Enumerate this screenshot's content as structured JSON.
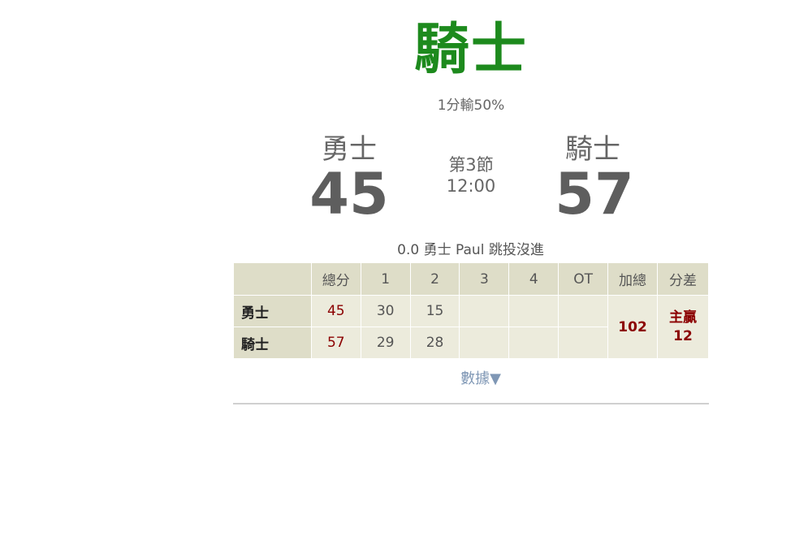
{
  "header": {
    "winner_team": "騎士",
    "winner_subtitle": "1分輸50%"
  },
  "scoreboard": {
    "home": {
      "name": "勇士",
      "score": "45"
    },
    "away": {
      "name": "騎士",
      "score": "57"
    },
    "period": "第3節",
    "clock": "12:00"
  },
  "last_play": "0.0 勇士 Paul 跳投沒進",
  "box_score": {
    "headers": [
      "",
      "總分",
      "1",
      "2",
      "3",
      "4",
      "OT",
      "加總",
      "分差"
    ],
    "rows": [
      {
        "team": "勇士",
        "total": "45",
        "q1": "30",
        "q2": "15",
        "q3": "",
        "q4": "",
        "ot": ""
      },
      {
        "team": "騎士",
        "total": "57",
        "q1": "29",
        "q2": "28",
        "q3": "",
        "q4": "",
        "ot": ""
      }
    ],
    "combined_total": "102",
    "diff_label": "主贏",
    "diff_value": "12"
  },
  "data_toggle_label": "數據▼",
  "colors": {
    "winner": "#1d8a1d",
    "score_red": "#8b0000",
    "header_bg": "#deddc8",
    "cell_bg": "#ecebdc",
    "link": "#7f97b5"
  }
}
